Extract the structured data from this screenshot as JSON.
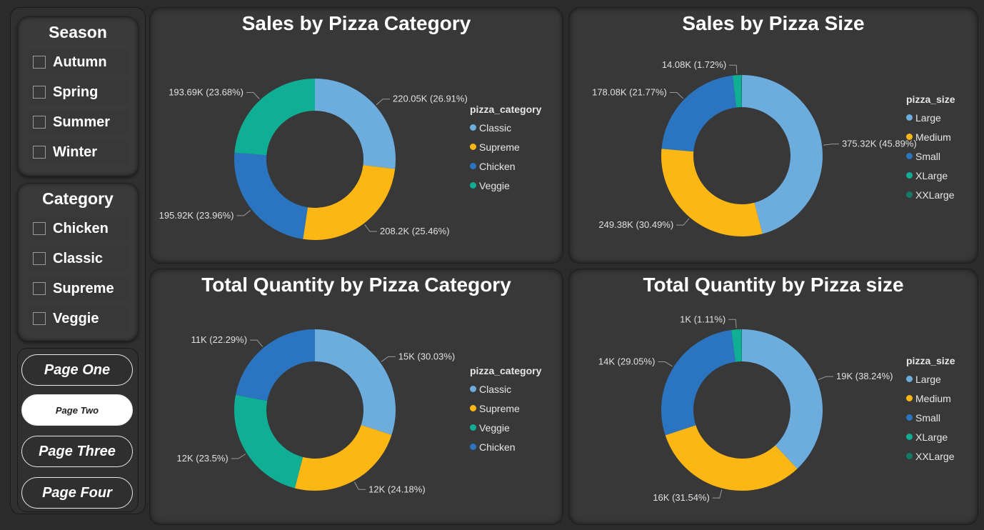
{
  "slicers": [
    {
      "title": "Season",
      "items": [
        "Autumn",
        "Spring",
        "Summer",
        "Winter"
      ]
    },
    {
      "title": "Category",
      "items": [
        "Chicken",
        "Classic",
        "Supreme",
        "Veggie"
      ]
    }
  ],
  "nav": {
    "buttons": [
      "Page One",
      "Page Two",
      "Page Three",
      "Page Four"
    ],
    "active": "Page Two"
  },
  "colors": {
    "Classic": "#6cadde",
    "Supreme": "#fdb714",
    "Chicken": "#2a74c0",
    "Veggie": "#10af95",
    "Large": "#6cadde",
    "Medium": "#fdb714",
    "Small": "#2a74c0",
    "XLarge": "#10af95",
    "XXLarge": "#137a68"
  },
  "chart_data": [
    {
      "type": "pie",
      "title": "Sales by Pizza Category",
      "legend_title": "pizza_category",
      "legend_order": [
        "Classic",
        "Supreme",
        "Chicken",
        "Veggie"
      ],
      "slices": [
        {
          "name": "Classic",
          "value": 220.05,
          "label": "220.05K (26.91%)"
        },
        {
          "name": "Supreme",
          "value": 208.2,
          "label": "208.2K (25.46%)"
        },
        {
          "name": "Chicken",
          "value": 195.92,
          "label": "195.92K (23.96%)"
        },
        {
          "name": "Veggie",
          "value": 193.69,
          "label": "193.69K (23.68%)"
        }
      ]
    },
    {
      "type": "pie",
      "title": "Sales by Pizza Size",
      "legend_title": "pizza_size",
      "legend_order": [
        "Large",
        "Medium",
        "Small",
        "XLarge",
        "XXLarge"
      ],
      "slices": [
        {
          "name": "Large",
          "value": 375.32,
          "label": "375.32K (45.89%)"
        },
        {
          "name": "Medium",
          "value": 249.38,
          "label": "249.38K (30.49%)"
        },
        {
          "name": "Small",
          "value": 178.08,
          "label": "178.08K (21.77%)"
        },
        {
          "name": "XLarge",
          "value": 14.08,
          "label": "14.08K (1.72%)"
        },
        {
          "name": "XXLarge",
          "value": 1.0,
          "label": ""
        }
      ]
    },
    {
      "type": "pie",
      "title": "Total Quantity by Pizza Category",
      "legend_title": "pizza_category",
      "legend_order": [
        "Classic",
        "Supreme",
        "Veggie",
        "Chicken"
      ],
      "slices": [
        {
          "name": "Classic",
          "value": 15,
          "label": "15K (30.03%)"
        },
        {
          "name": "Supreme",
          "value": 12,
          "label": "12K (24.18%)"
        },
        {
          "name": "Veggie",
          "value": 12,
          "label": "12K (23.5%)"
        },
        {
          "name": "Chicken",
          "value": 11,
          "label": "11K (22.29%)"
        }
      ]
    },
    {
      "type": "pie",
      "title": "Total Quantity by Pizza size",
      "legend_title": "pizza_size",
      "legend_order": [
        "Large",
        "Medium",
        "Small",
        "XLarge",
        "XXLarge"
      ],
      "slices": [
        {
          "name": "Large",
          "value": 19,
          "label": "19K (38.24%)"
        },
        {
          "name": "Medium",
          "value": 16,
          "label": "16K (31.54%)"
        },
        {
          "name": "Small",
          "value": 14,
          "label": "14K (29.05%)"
        },
        {
          "name": "XLarge",
          "value": 1,
          "label": "1K (1.11%)"
        },
        {
          "name": "XXLarge",
          "value": 0.05,
          "label": ""
        }
      ]
    }
  ]
}
